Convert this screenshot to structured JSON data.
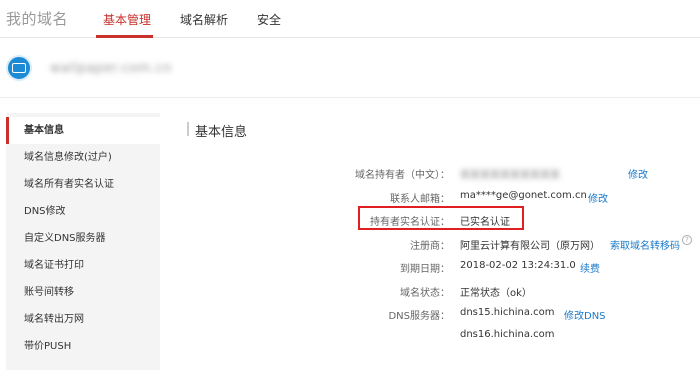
{
  "header": {
    "brand": "我的域名",
    "tabs": [
      {
        "label": "基本管理",
        "active": true
      },
      {
        "label": "域名解析",
        "active": false
      },
      {
        "label": "安全",
        "active": false
      }
    ]
  },
  "domain": {
    "name": "wallpaper.com.cn"
  },
  "sidebar": {
    "items": [
      {
        "label": "基本信息",
        "active": true
      },
      {
        "label": "域名信息修改(过户)"
      },
      {
        "label": "域名所有者实名认证"
      },
      {
        "label": "DNS修改"
      },
      {
        "label": "自定义DNS服务器"
      },
      {
        "label": "域名证书打印"
      },
      {
        "label": "账号间转移"
      },
      {
        "label": "域名转出万网"
      },
      {
        "label": "带价PUSH"
      }
    ]
  },
  "main": {
    "section_title": "基本信息",
    "rows": {
      "owner": {
        "label": "域名持有者（中文）：",
        "value": "某某某某某某某某某某",
        "link": "修改"
      },
      "email": {
        "label": "联系人邮箱：",
        "value": "ma****ge@gonet.com.cn",
        "link": "修改"
      },
      "realname": {
        "label": "持有者实名认证：",
        "value": "已实名认证"
      },
      "registrar": {
        "label": "注册商：",
        "value": "阿里云计算有限公司（原万网）",
        "link": "索取域名转移码"
      },
      "expiry": {
        "label": "到期日期：",
        "value": "2018-02-02 13:24:31.0",
        "link": "续费"
      },
      "status": {
        "label": "域名状态：",
        "value": "正常状态（ok）"
      },
      "dns": {
        "label": "DNS服务器：",
        "values": [
          "dns15.hichina.com",
          "dns16.hichina.com"
        ],
        "link": "修改DNS"
      }
    }
  },
  "colors": {
    "accent": "#c9302c",
    "link": "#1a79c9",
    "highlight": "#e02020"
  }
}
